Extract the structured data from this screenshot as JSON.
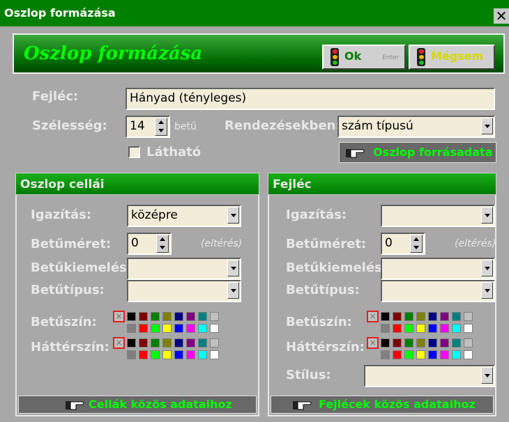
{
  "window": {
    "title": "Oszlop formázása",
    "close_glyph": "✕"
  },
  "banner": {
    "title": "Oszlop formázása",
    "ok_label": "Ok",
    "enter_hint": "Enter",
    "cancel_label": "Mégsem"
  },
  "top": {
    "header_label": "Fejléc:",
    "header_value": "Hányad (tényleges)",
    "width_label": "Szélesség:",
    "width_value": "14",
    "width_unit": "betű",
    "sort_label": "Rendezésekben:",
    "sort_value": "szám típusú",
    "visible_label": "Látható",
    "visible_checked": false,
    "source_button": "Oszlop forrásadata"
  },
  "cells_panel": {
    "title": "Oszlop cellái",
    "align_label": "Igazítás:",
    "align_value": "középre",
    "size_label": "Betűméret:",
    "size_value": "0",
    "size_hint": "(eltérés)",
    "emph_label": "Betűkiemelés:",
    "emph_value": "",
    "type_label": "Betűtípus:",
    "type_value": "",
    "fg_label": "Betűszín:",
    "bg_label": "Háttérszín:",
    "bottom_button": "Cellák közös adataihoz"
  },
  "header_panel": {
    "title": "Fejléc",
    "align_label": "Igazítás:",
    "align_value": "",
    "size_label": "Betűméret:",
    "size_value": "0",
    "size_hint": "(eltérés)",
    "emph_label": "Betűkiemelés:",
    "emph_value": "",
    "type_label": "Betűtípus:",
    "type_value": "",
    "fg_label": "Betűszín:",
    "bg_label": "Háttérszín:",
    "style_label": "Stílus:",
    "style_value": "",
    "bottom_button": "Fejlécek közös adataihoz"
  },
  "palette": {
    "row1": [
      "#000000",
      "#800000",
      "#008000",
      "#808000",
      "#000080",
      "#800080",
      "#008080",
      "#c0c0c0"
    ],
    "row2": [
      "#808080",
      "#ff0000",
      "#00ff00",
      "#ffff00",
      "#0000ff",
      "#ff00ff",
      "#00ffff",
      "#ffffff"
    ]
  },
  "colors": {
    "accent": "#008000",
    "banner_text": "#00ff00",
    "field_bg": "#f2ecd8",
    "dialog_bg": "#a8a8a8",
    "button_text": "#00ff00"
  }
}
